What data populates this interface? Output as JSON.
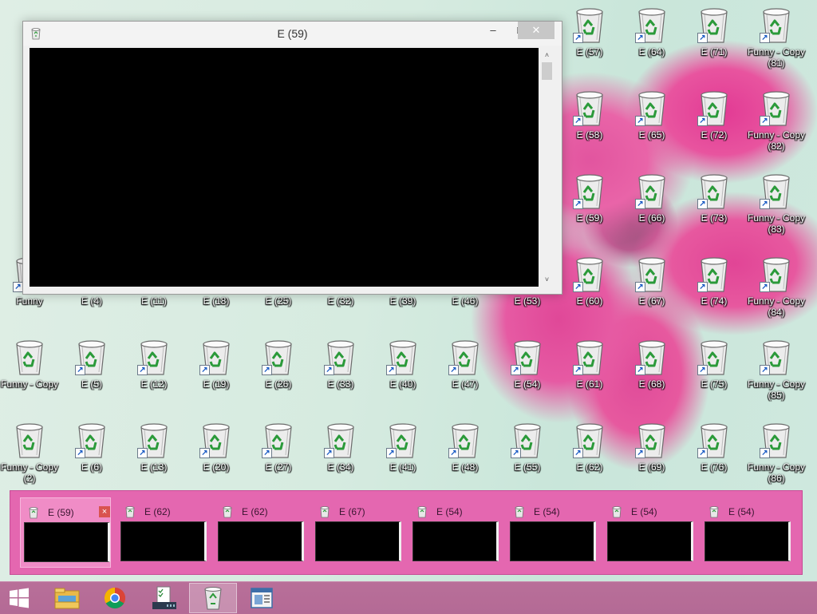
{
  "desktop": {
    "icons": [
      {
        "label": "Funny",
        "shortcut": true
      },
      {
        "label": "E (4)",
        "shortcut": true
      },
      {
        "label": "E (11)",
        "shortcut": true
      },
      {
        "label": "E (18)",
        "shortcut": true
      },
      {
        "label": "E (25)",
        "shortcut": true
      },
      {
        "label": "E (32)",
        "shortcut": true
      },
      {
        "label": "E (39)",
        "shortcut": true
      },
      {
        "label": "E (46)",
        "shortcut": true
      },
      {
        "label": "E (53)",
        "shortcut": true
      },
      {
        "label": "E (57)",
        "shortcut": true
      },
      {
        "label": "E (64)",
        "shortcut": true
      },
      {
        "label": "E (71)",
        "shortcut": true
      },
      {
        "label": "Funny - Copy\n(81)",
        "shortcut": true
      },
      {
        "label": "E (58)",
        "shortcut": true
      },
      {
        "label": "E (65)",
        "shortcut": true
      },
      {
        "label": "E (72)",
        "shortcut": true
      },
      {
        "label": "Funny - Copy\n(82)",
        "shortcut": true
      },
      {
        "label": "E (59)",
        "shortcut": true
      },
      {
        "label": "E (66)",
        "shortcut": true
      },
      {
        "label": "E (73)",
        "shortcut": true
      },
      {
        "label": "Funny - Copy\n(83)",
        "shortcut": true
      },
      {
        "label": "E (60)",
        "shortcut": true
      },
      {
        "label": "E (67)",
        "shortcut": true
      },
      {
        "label": "E (74)",
        "shortcut": true
      },
      {
        "label": "Funny - Copy\n(84)",
        "shortcut": true
      },
      {
        "label": "Funny - Copy",
        "shortcut": false
      },
      {
        "label": "E (5)",
        "shortcut": true
      },
      {
        "label": "E (12)",
        "shortcut": true
      },
      {
        "label": "E (19)",
        "shortcut": true
      },
      {
        "label": "E (26)",
        "shortcut": true
      },
      {
        "label": "E (33)",
        "shortcut": true
      },
      {
        "label": "E (40)",
        "shortcut": true
      },
      {
        "label": "E (47)",
        "shortcut": true
      },
      {
        "label": "E (54)",
        "shortcut": true
      },
      {
        "label": "E (61)",
        "shortcut": true
      },
      {
        "label": "E (68)",
        "shortcut": true
      },
      {
        "label": "E (75)",
        "shortcut": true
      },
      {
        "label": "Funny - Copy\n(85)",
        "shortcut": true
      },
      {
        "label": "Funny - Copy\n(2)",
        "shortcut": false
      },
      {
        "label": "E (6)",
        "shortcut": true
      },
      {
        "label": "E (13)",
        "shortcut": true
      },
      {
        "label": "E (20)",
        "shortcut": true
      },
      {
        "label": "E (27)",
        "shortcut": true
      },
      {
        "label": "E (34)",
        "shortcut": true
      },
      {
        "label": "E (41)",
        "shortcut": true
      },
      {
        "label": "E (48)",
        "shortcut": true
      },
      {
        "label": "E (55)",
        "shortcut": true
      },
      {
        "label": "E (62)",
        "shortcut": true
      },
      {
        "label": "E (69)",
        "shortcut": true
      },
      {
        "label": "E (76)",
        "shortcut": true
      },
      {
        "label": "Funny - Copy\n(86)",
        "shortcut": true
      }
    ]
  },
  "window": {
    "title": "E (59)",
    "minimize_glyph": "–",
    "maximize_glyph": "□",
    "close_glyph": "✕",
    "scroll_up_glyph": "˄",
    "scroll_down_glyph": "˅"
  },
  "switcher": {
    "items": [
      {
        "title": "E (59)",
        "selected": true,
        "close_glyph": "×"
      },
      {
        "title": "E (62)",
        "selected": false
      },
      {
        "title": "E (62)",
        "selected": false
      },
      {
        "title": "E (67)",
        "selected": false
      },
      {
        "title": "E (54)",
        "selected": false
      },
      {
        "title": "E (54)",
        "selected": false
      },
      {
        "title": "E (54)",
        "selected": false
      },
      {
        "title": "E (54)",
        "selected": false
      }
    ]
  },
  "taskbar": {
    "items": [
      {
        "name": "start-button",
        "icon": "windows-logo-icon"
      },
      {
        "name": "file-explorer",
        "icon": "folder-icon"
      },
      {
        "name": "chrome",
        "icon": "chrome-icon"
      },
      {
        "name": "task-manager",
        "icon": "task-manager-icon"
      },
      {
        "name": "recycle-bin",
        "icon": "recycle-bin-icon",
        "active": true
      },
      {
        "name": "app",
        "icon": "window-app-icon"
      }
    ]
  },
  "colors": {
    "switcher_bg": "#e467b0",
    "taskbar_bg": "#b86f99",
    "selected_thumb": "#f08cc6"
  }
}
